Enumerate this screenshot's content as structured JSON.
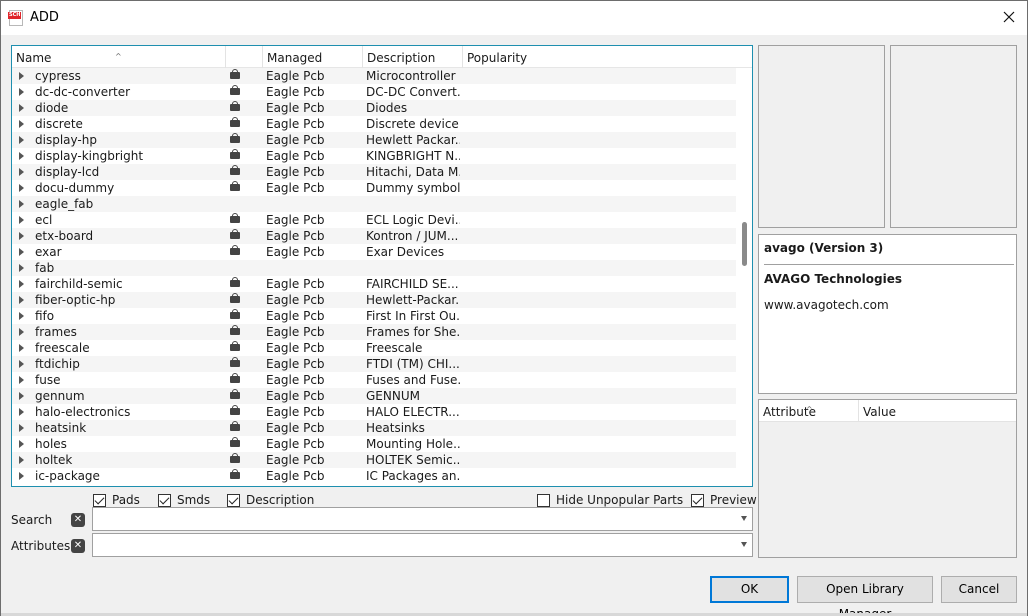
{
  "window": {
    "title": "ADD",
    "app_icon_text": "SCH"
  },
  "list": {
    "columns": [
      "Name",
      "",
      "Managed Folder",
      "Description",
      "Popularity"
    ],
    "rows": [
      {
        "name": "cypress",
        "locked": true,
        "folder": "Eagle Pcb",
        "description": "Microcontroller ..."
      },
      {
        "name": "dc-dc-converter",
        "locked": true,
        "folder": "Eagle Pcb",
        "description": "DC-DC Convert..."
      },
      {
        "name": "diode",
        "locked": true,
        "folder": "Eagle Pcb",
        "description": "Diodes"
      },
      {
        "name": "discrete",
        "locked": true,
        "folder": "Eagle Pcb",
        "description": "Discrete device..."
      },
      {
        "name": "display-hp",
        "locked": true,
        "folder": "Eagle Pcb",
        "description": "Hewlett Packar..."
      },
      {
        "name": "display-kingbright",
        "locked": true,
        "folder": "Eagle Pcb",
        "description": "KINGBRIGHT N..."
      },
      {
        "name": "display-lcd",
        "locked": true,
        "folder": "Eagle Pcb",
        "description": "Hitachi, Data M..."
      },
      {
        "name": "docu-dummy",
        "locked": true,
        "folder": "Eagle Pcb",
        "description": "Dummy symbols"
      },
      {
        "name": "eagle_fab",
        "locked": false,
        "folder": "",
        "description": ""
      },
      {
        "name": "ecl",
        "locked": true,
        "folder": "Eagle Pcb",
        "description": "ECL Logic Devi..."
      },
      {
        "name": "etx-board",
        "locked": true,
        "folder": "Eagle Pcb",
        "description": "Kontron / JUM..."
      },
      {
        "name": "exar",
        "locked": true,
        "folder": "Eagle Pcb",
        "description": "Exar Devices"
      },
      {
        "name": "fab",
        "locked": false,
        "folder": "",
        "description": ""
      },
      {
        "name": "fairchild-semic",
        "locked": true,
        "folder": "Eagle Pcb",
        "description": "FAIRCHILD SE..."
      },
      {
        "name": "fiber-optic-hp",
        "locked": true,
        "folder": "Eagle Pcb",
        "description": "Hewlett-Packar..."
      },
      {
        "name": "fifo",
        "locked": true,
        "folder": "Eagle Pcb",
        "description": "First In First Ou..."
      },
      {
        "name": "frames",
        "locked": true,
        "folder": "Eagle Pcb",
        "description": "Frames for She..."
      },
      {
        "name": "freescale",
        "locked": true,
        "folder": "Eagle Pcb",
        "description": "Freescale"
      },
      {
        "name": "ftdichip",
        "locked": true,
        "folder": "Eagle Pcb",
        "description": "FTDI (TM) CHI..."
      },
      {
        "name": "fuse",
        "locked": true,
        "folder": "Eagle Pcb",
        "description": "Fuses and Fuse..."
      },
      {
        "name": "gennum",
        "locked": true,
        "folder": "Eagle Pcb",
        "description": "GENNUM"
      },
      {
        "name": "halo-electronics",
        "locked": true,
        "folder": "Eagle Pcb",
        "description": "HALO ELECTR..."
      },
      {
        "name": "heatsink",
        "locked": true,
        "folder": "Eagle Pcb",
        "description": "Heatsinks"
      },
      {
        "name": "holes",
        "locked": true,
        "folder": "Eagle Pcb",
        "description": "Mounting Hole..."
      },
      {
        "name": "holtek",
        "locked": true,
        "folder": "Eagle Pcb",
        "description": "HOLTEK Semic..."
      },
      {
        "name": "ic-package",
        "locked": true,
        "folder": "Eagle Pcb",
        "description": "IC Packages an..."
      }
    ]
  },
  "info": {
    "title": "avago (Version 3)",
    "company": "AVAGO Technologies",
    "url": "www.avagotech.com"
  },
  "attributes_table": {
    "col_attribute": "Attribute",
    "col_value": "Value"
  },
  "options": {
    "pads": {
      "label": "Pads",
      "checked": true
    },
    "smds": {
      "label": "Smds",
      "checked": true
    },
    "description": {
      "label": "Description",
      "checked": true
    },
    "hide_unpopular": {
      "label": "Hide Unpopular Parts",
      "checked": false
    },
    "preview": {
      "label": "Preview",
      "checked": true
    }
  },
  "search": {
    "label": "Search",
    "value": ""
  },
  "attributes_filter": {
    "label": "Attributes",
    "value": ""
  },
  "buttons": {
    "ok": "OK",
    "open_library_manager": "Open Library Manager",
    "cancel": "Cancel"
  }
}
